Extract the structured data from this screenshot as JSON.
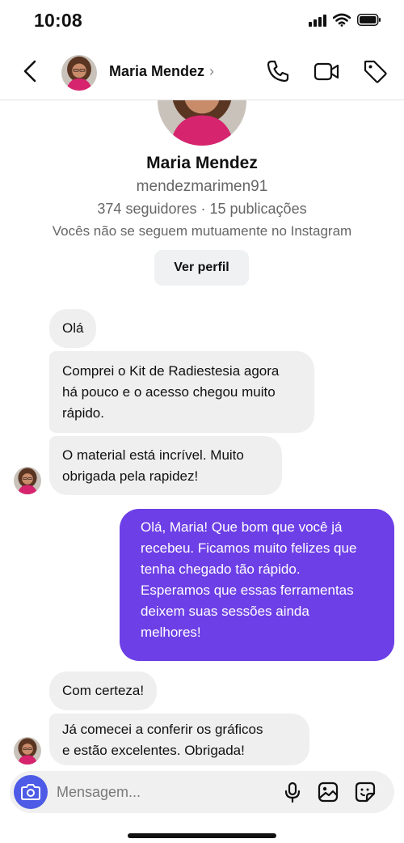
{
  "status_bar": {
    "time": "10:08"
  },
  "header": {
    "name": "Maria Mendez",
    "chevron": "›",
    "icons": [
      "back-icon",
      "phone-icon",
      "video-camera-icon",
      "tag-icon"
    ]
  },
  "profile": {
    "name": "Maria Mendez",
    "username": "mendezmarimen91",
    "stats": "374 seguidores · 15 publicações",
    "mutual": "Vocês não se seguem mutuamente no Instagram",
    "view_profile_label": "Ver perfil"
  },
  "messages": [
    {
      "from": "them",
      "lines": [
        "Olá"
      ]
    },
    {
      "from": "them",
      "lines": [
        "Comprei o Kit de Radiestesia agora",
        "há pouco e o acesso chegou muito",
        "rápido."
      ]
    },
    {
      "from": "them",
      "lines": [
        "O material está incrível. Muito",
        "obrigada pela rapidez!"
      ]
    },
    {
      "from": "me",
      "lines": [
        "Olá, Maria! Que bom que você já",
        "recebeu. Ficamos muito felizes que",
        "tenha chegado tão rápido.",
        "Esperamos que essas ferramentas",
        "deixem suas sessões ainda",
        "melhores!"
      ]
    },
    {
      "from": "them",
      "lines": [
        "Com certeza!"
      ]
    },
    {
      "from": "them",
      "lines": [
        "Já comecei a conferir os gráficos",
        "e estão excelentes. Obrigada!"
      ]
    }
  ],
  "composer": {
    "placeholder": "Mensagem...",
    "icons": [
      "camera-icon",
      "microphone-icon",
      "gallery-icon",
      "sticker-icon"
    ]
  },
  "colors": {
    "outgoing_bubble": "#6d3fe6",
    "incoming_bubble": "#efefef",
    "camera_button": "#4d5be6"
  }
}
